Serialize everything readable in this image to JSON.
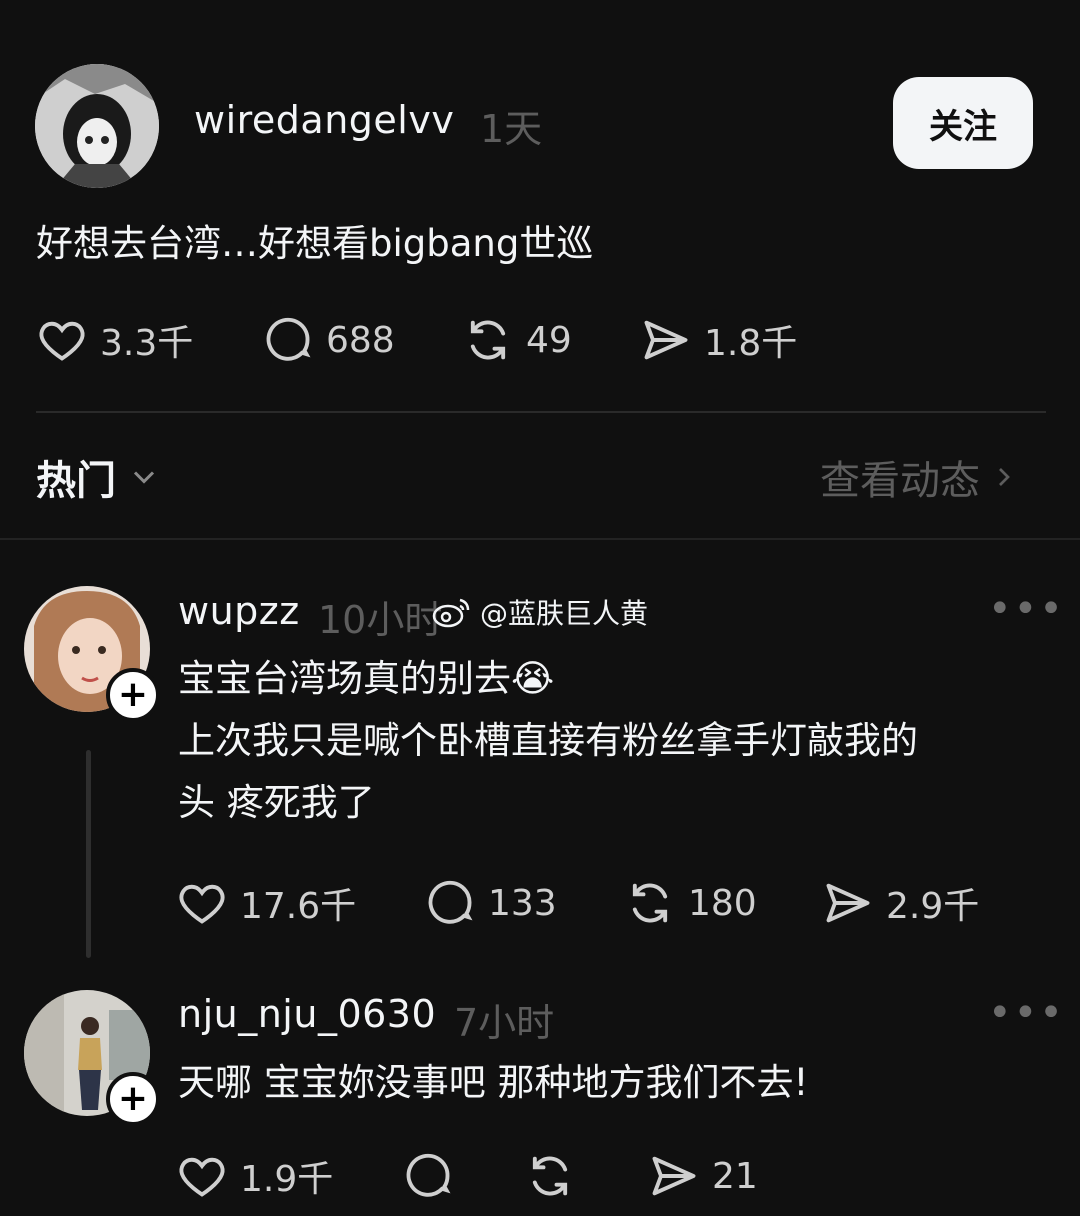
{
  "post": {
    "username": "wiredangelvv",
    "time": "1天",
    "follow_label": "关注",
    "text": "好想去台湾…好想看bigbang世巡",
    "likes": "3.3千",
    "comments": "688",
    "reposts": "49",
    "shares": "1.8千"
  },
  "filter": {
    "label": "热门",
    "view_activity": "查看动态"
  },
  "replies": [
    {
      "username": "wupzz",
      "time": "10小时",
      "lines": [
        "宝宝台湾场真的别去😭",
        "上次我只是喊个卧槽直接有粉丝拿手灯敲我的",
        "头 疼死我了"
      ],
      "likes": "17.6千",
      "comments": "133",
      "reposts": "180",
      "shares": "2.9千"
    },
    {
      "username": "nju_nju_0630",
      "time": "7小时",
      "lines": [
        "天哪 宝宝妳没事吧 那种地方我们不去!"
      ],
      "likes": "1.9千",
      "shares": "21"
    }
  ],
  "watermark": "@蓝肤巨人黄",
  "icons": [
    "heart-icon",
    "comment-icon",
    "repost-icon",
    "share-icon",
    "chevron-down-icon",
    "chevron-right-icon",
    "more-icon",
    "plus-icon",
    "weibo-logo-icon"
  ]
}
